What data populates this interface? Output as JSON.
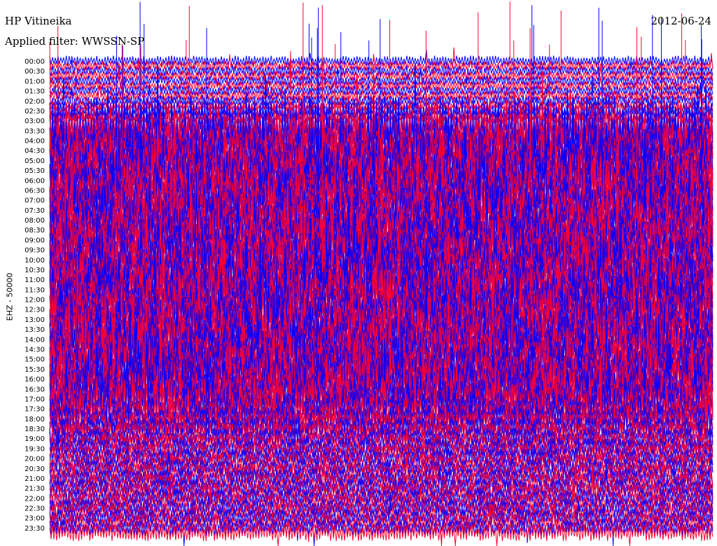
{
  "header": {
    "station": "HP Vitineika",
    "date": "2012-06-24",
    "filter_label": "Applied filter:",
    "filter_name": "WWSSN-SP"
  },
  "side_label": "EHZ - 50000",
  "colors": {
    "background": "#ffffff",
    "text": "#000000",
    "trace_a": "#0000ff",
    "trace_b": "#ff0033"
  },
  "chart_data": {
    "type": "line",
    "title": "HP Vitineika",
    "subtitle": "2012-06-24",
    "ylabel": "EHZ - 50000",
    "xlabel": "",
    "grid": false,
    "legend": "none",
    "line_interval_minutes": 15,
    "line_count": 96,
    "trace_colors_alternating": [
      "#0000ff",
      "#ff0033"
    ],
    "y_tick_labels": [
      "00:00",
      "00:30",
      "01:00",
      "01:30",
      "02:00",
      "02:30",
      "03:00",
      "03:30",
      "04:00",
      "04:30",
      "05:00",
      "05:30",
      "06:00",
      "06:30",
      "07:00",
      "07:30",
      "08:00",
      "08:30",
      "09:00",
      "09:30",
      "10:00",
      "10:30",
      "11:00",
      "11:30",
      "12:00",
      "12:30",
      "13:00",
      "13:30",
      "14:00",
      "14:30",
      "15:00",
      "15:30",
      "16:00",
      "16:30",
      "17:00",
      "17:30",
      "18:00",
      "18:30",
      "19:00",
      "19:30",
      "20:00",
      "20:30",
      "21:00",
      "21:30",
      "22:00",
      "22:30",
      "23:00",
      "23:30"
    ],
    "relative_amplitude_by_half_hour": [
      0.15,
      0.16,
      0.15,
      0.17,
      0.18,
      0.3,
      1.0,
      1.0,
      1.0,
      1.0,
      1.0,
      1.0,
      1.0,
      1.0,
      1.0,
      1.0,
      1.0,
      1.0,
      1.0,
      1.0,
      1.0,
      1.0,
      1.0,
      1.0,
      1.0,
      1.0,
      1.0,
      1.0,
      1.0,
      1.0,
      1.0,
      1.0,
      1.0,
      0.95,
      0.85,
      0.7,
      0.55,
      0.45,
      0.4,
      0.38,
      0.36,
      0.35,
      0.35,
      0.34,
      0.34,
      0.33,
      0.32,
      0.3
    ]
  }
}
